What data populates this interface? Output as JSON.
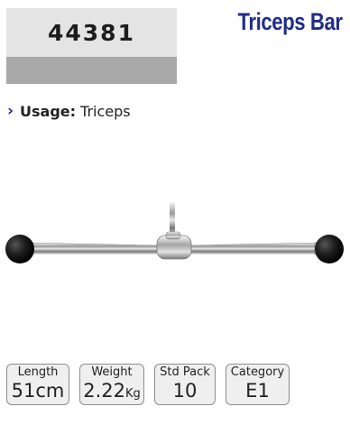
{
  "product": {
    "code": "44381",
    "title": "Triceps Bar",
    "usage_label": "Usage:",
    "usage_value": "Triceps",
    "image": "triceps-bar-image"
  },
  "specs": [
    {
      "label": "Length",
      "value": "51cm"
    },
    {
      "label": "Weight",
      "value": "2.22",
      "unit": "Kg"
    },
    {
      "label": "Std Pack",
      "value": "10"
    },
    {
      "label": "Category",
      "value": "E1"
    }
  ],
  "colors": {
    "title": "#1f2d86",
    "code_band_top": "#e4e4e4",
    "code_band_bottom": "#a9a9a9"
  }
}
